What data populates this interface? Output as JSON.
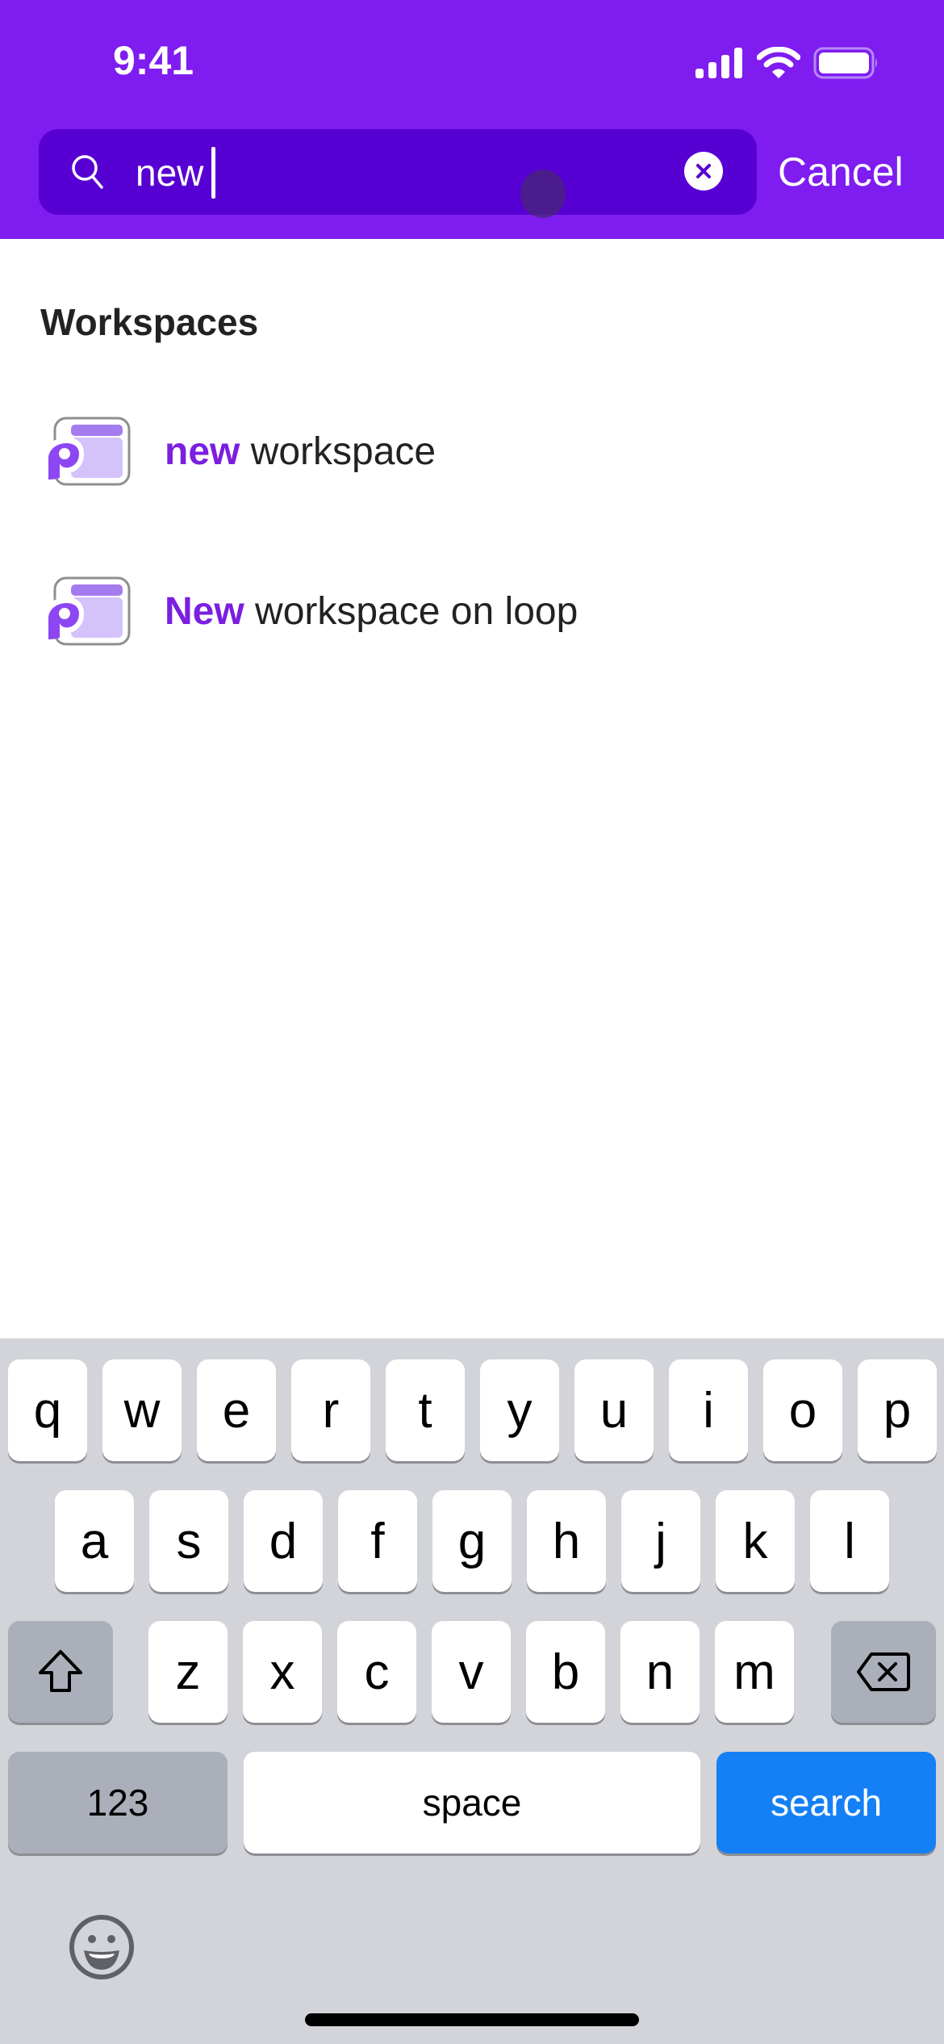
{
  "status_bar": {
    "time": "9:41",
    "icons": [
      "cellular-signal-icon",
      "wifi-icon",
      "battery-icon"
    ]
  },
  "search": {
    "value": "new",
    "clear_icon": "clear-circle-icon",
    "search_icon": "magnifier-icon",
    "cancel_label": "Cancel"
  },
  "results": {
    "section_title": "Workspaces",
    "items": [
      {
        "highlight": "new",
        "rest": " workspace",
        "icon": "workspace-icon"
      },
      {
        "highlight": "New",
        "rest": " workspace on loop",
        "icon": "workspace-icon"
      }
    ]
  },
  "keyboard": {
    "row1": [
      "q",
      "w",
      "e",
      "r",
      "t",
      "y",
      "u",
      "i",
      "o",
      "p"
    ],
    "row2": [
      "a",
      "s",
      "d",
      "f",
      "g",
      "h",
      "j",
      "k",
      "l"
    ],
    "row3": [
      "z",
      "x",
      "c",
      "v",
      "b",
      "n",
      "m"
    ],
    "numbers_label": "123",
    "space_label": "space",
    "action_label": "search",
    "shift_icon": "shift-icon",
    "delete_icon": "backspace-icon",
    "emoji_icon": "emoji-icon"
  },
  "colors": {
    "header": "#7f1cf0",
    "search_field": "#5700d3",
    "highlight": "#7a1fe0",
    "action_key": "#1580f5",
    "keyboard_bg": "#d3d4d9"
  }
}
